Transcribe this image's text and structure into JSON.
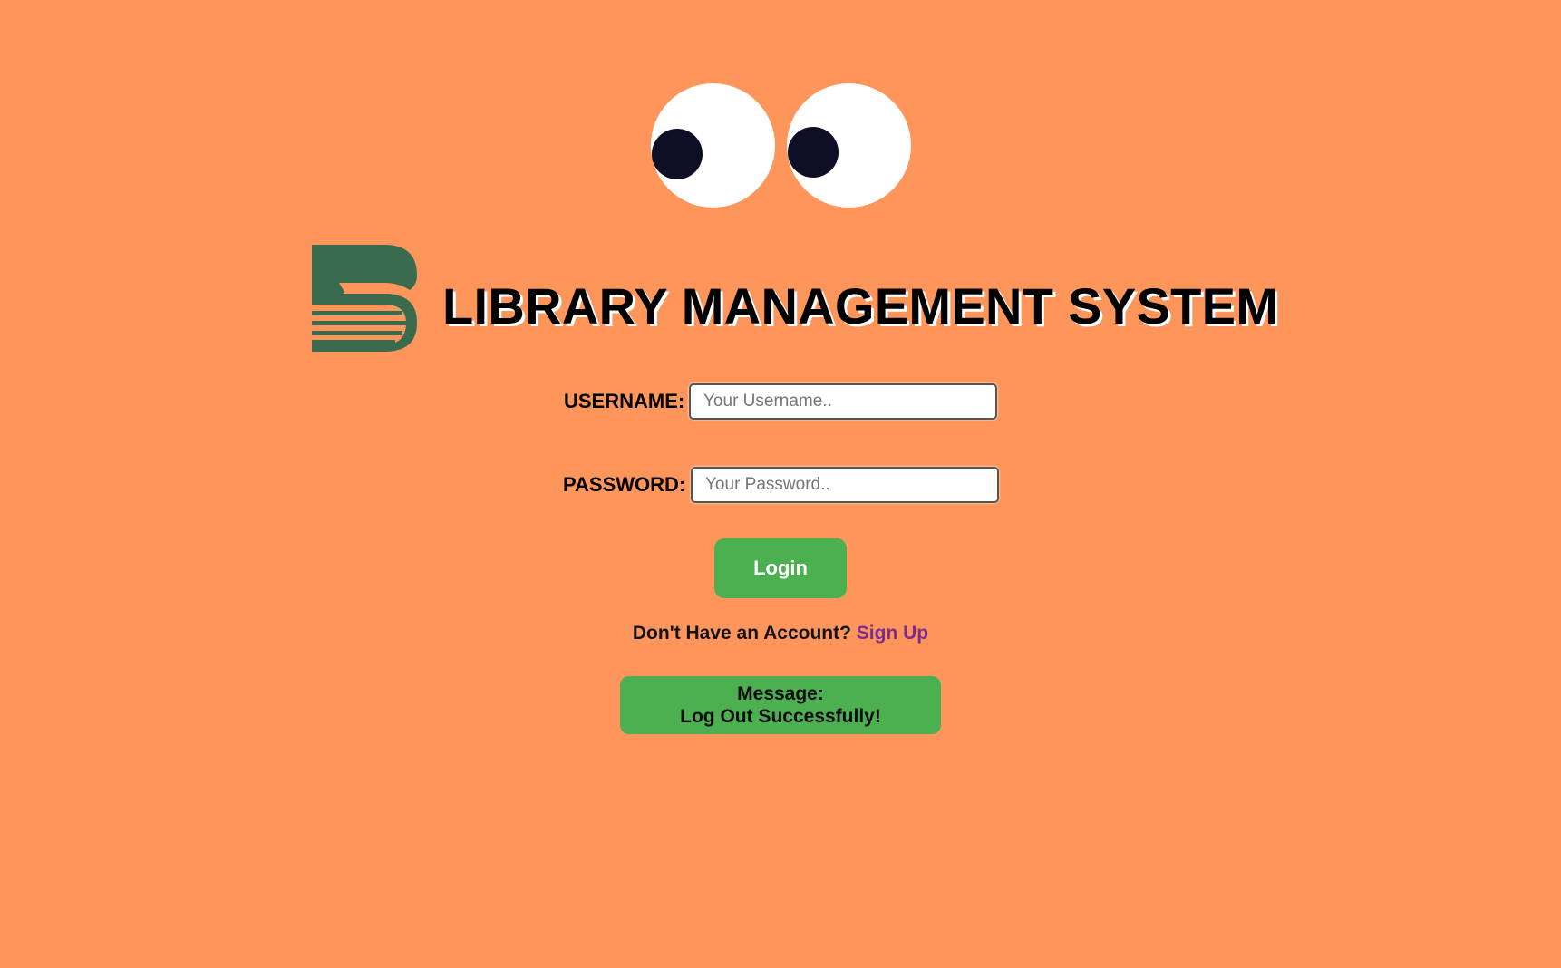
{
  "eyes": {
    "sclera_color": "#ffffff",
    "pupil_color": "#0e0f24"
  },
  "logo": {
    "icon": "library-book-logo",
    "color": "#3A6B4F"
  },
  "header": {
    "title": "LIBRARY MANAGEMENT SYSTEM"
  },
  "login_form": {
    "username": {
      "label": "USERNAME:",
      "placeholder": "Your Username..",
      "value": ""
    },
    "password": {
      "label": "PASSWORD:",
      "placeholder": "Your Password..",
      "value": ""
    },
    "submit_label": "Login"
  },
  "signup": {
    "prompt": "Don't Have an Account?",
    "link_label": "Sign Up"
  },
  "message": {
    "heading": "Message:",
    "text": "Log Out Successfully!"
  },
  "colors": {
    "background": "#FE955B",
    "button_green": "#4CAF50",
    "link_purple": "#7B2C91"
  }
}
